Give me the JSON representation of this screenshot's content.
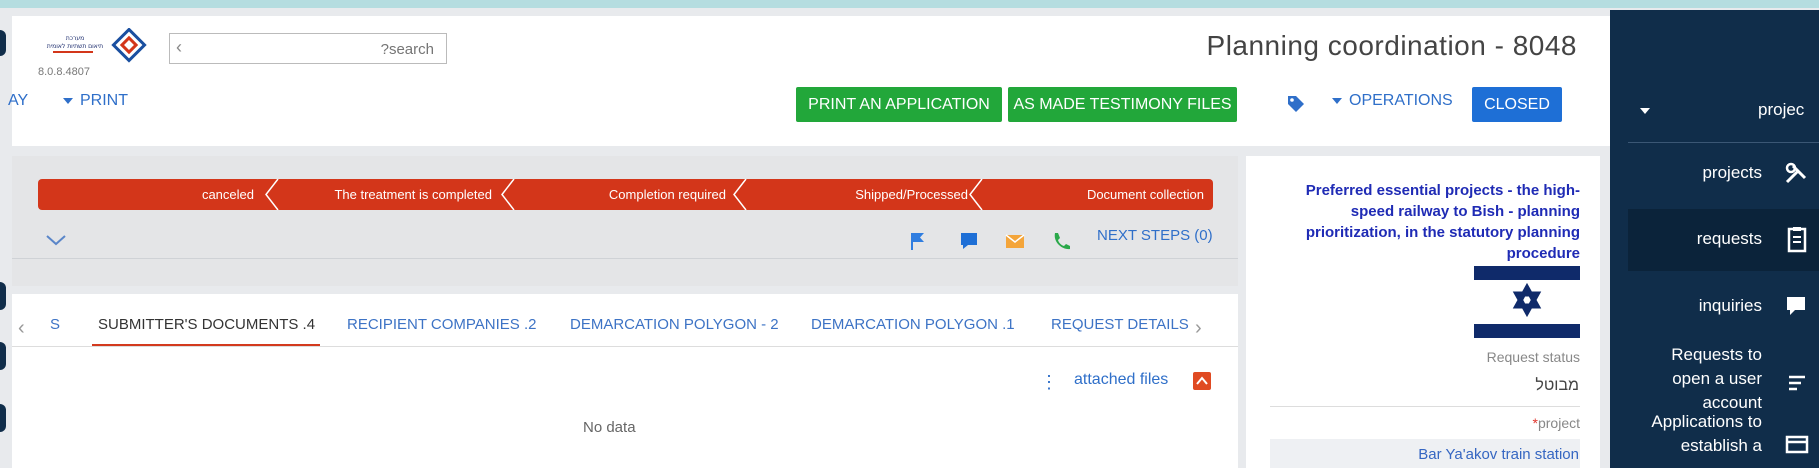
{
  "header": {
    "version": "8.0.8.4807",
    "search_placeholder": "?search",
    "title": "Planning coordination - 8048",
    "left_cut_label": "AY",
    "print_label": "PRINT",
    "print_app_label": "PRINT AN APPLICATION",
    "as_made_label": "AS MADE TESTIMONY FILES",
    "operations_label": "OPERATIONS",
    "closed_label": "CLOSED",
    "logo_text_lines": [
      "מערכת",
      "תיאום תשתיות לאומית"
    ]
  },
  "workflow": {
    "steps": [
      "canceled",
      "The treatment is completed",
      "Completion required",
      "Shipped/Processed",
      "Document collection"
    ],
    "next_steps_label": "NEXT STEPS (0)"
  },
  "tabs": {
    "items": [
      "S",
      "SUBMITTER'S DOCUMENTS .4",
      "RECIPIENT COMPANIES .2",
      "DEMARCATION POLYGON - 2",
      "DEMARCATION POLYGON .1",
      "REQUEST DETAILS"
    ],
    "active_index": 1,
    "section_title": "attached files",
    "empty_text": "No data"
  },
  "details": {
    "project_title": "Preferred essential projects - the high-speed railway to Bish - planning prioritization, in the statutory planning procedure",
    "status_label": "Request status",
    "status_value": "מבוטל",
    "project_label": "project",
    "project_value": "Bar Ya'akov train station"
  },
  "nav": {
    "top_label": "projec",
    "items": [
      "projects",
      "requests",
      "inquiries",
      "Requests to open a user account",
      "Applications to establish a"
    ],
    "selected_index": 1
  },
  "colors": {
    "accent_red": "#d3361a",
    "green": "#22a73a",
    "blue": "#1e6fd6",
    "nav_bg": "#102d4a",
    "link": "#2f6fc9"
  }
}
